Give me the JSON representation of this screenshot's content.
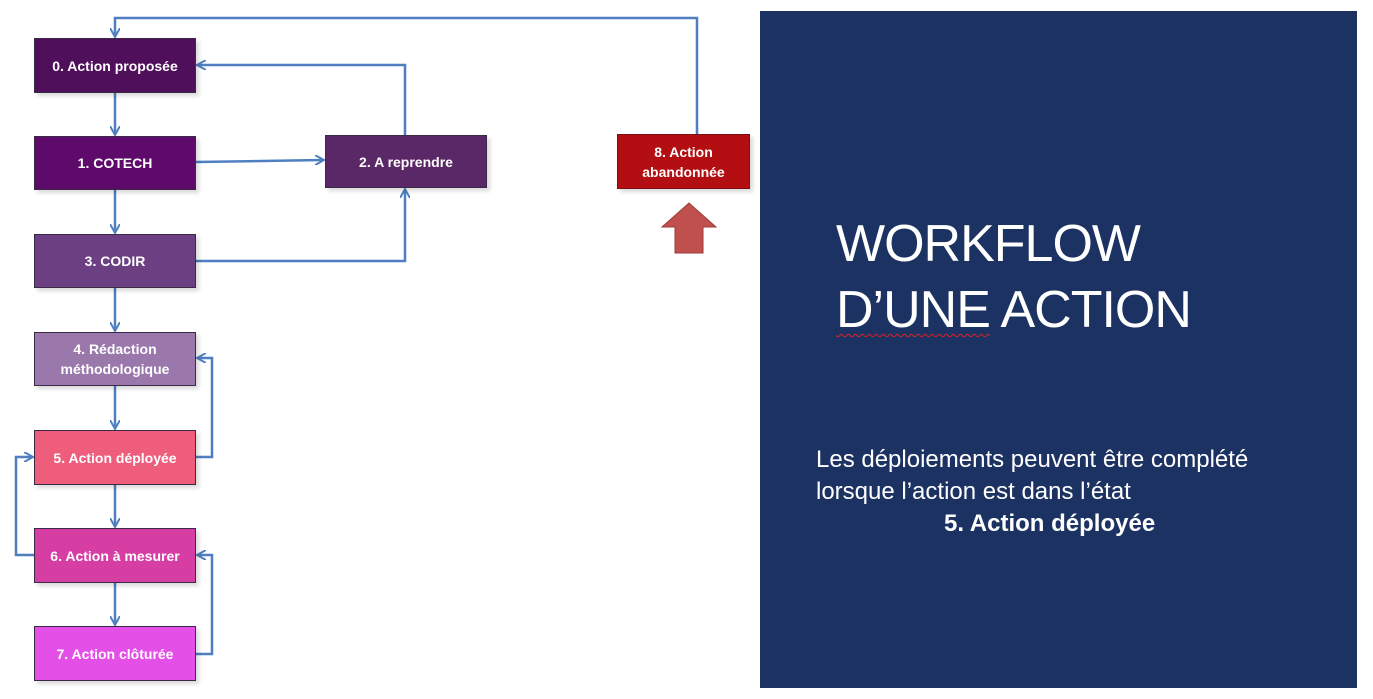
{
  "workflow": {
    "nodes": {
      "n0": "0. Action proposée",
      "n1": "1. COTECH",
      "n2": "2. A reprendre",
      "n3": "3. CODIR",
      "n4": "4. Rédaction méthodologique",
      "n5": "5. Action déployée",
      "n6": "6. Action à mesurer",
      "n7": "7. Action clôturée",
      "n8": "8. Action abandonnée"
    }
  },
  "panel": {
    "title_line1": "WORKFLOW",
    "title_line2_part1": "D’UNE",
    "title_line2_part2": " ACTION",
    "desc_line1": "Les déploiements peuvent être complété",
    "desc_line2": "lorsque l’action est dans l’état",
    "desc_state": "5. Action déployée"
  },
  "colors": {
    "panel_bg": "#1c3262",
    "connector": "#4f7fc0",
    "up_arrow": "#c0504d"
  }
}
